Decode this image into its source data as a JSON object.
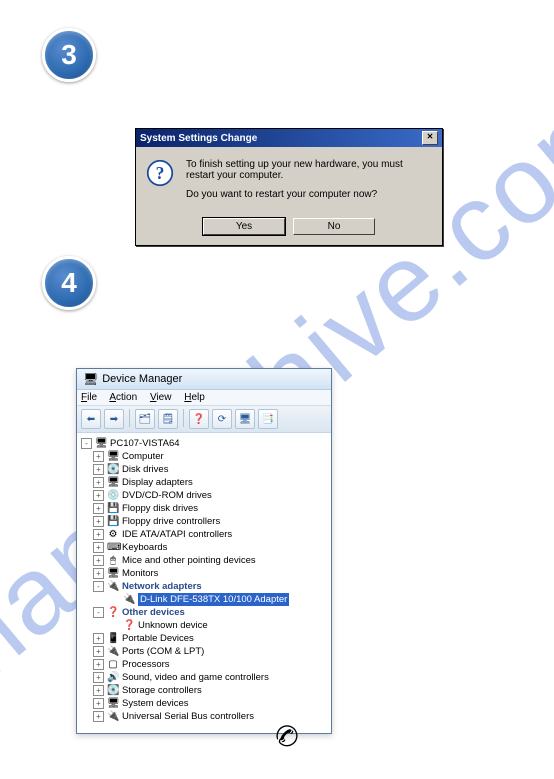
{
  "watermark": "manualshive.com",
  "steps": {
    "s3": "3",
    "s4": "4"
  },
  "dialog": {
    "title": "System Settings Change",
    "close_label": "✕",
    "msg1": "To finish setting up your new hardware, you must restart your computer.",
    "msg2": "Do you want to restart your computer now?",
    "yes": "Yes",
    "no": "No"
  },
  "devmgr": {
    "title": "Device Manager",
    "menu": {
      "file": "File",
      "action": "Action",
      "view": "View",
      "help": "Help"
    },
    "toolbar_icons": [
      "⬅",
      "➡",
      " ",
      "🗂",
      "🗒",
      " ",
      "❓",
      "⟳",
      "🖥",
      "📑"
    ],
    "root": "PC107-VISTA64",
    "nodes": [
      {
        "exp": "+",
        "icon": "🖥",
        "label": "Computer"
      },
      {
        "exp": "+",
        "icon": "💽",
        "label": "Disk drives"
      },
      {
        "exp": "+",
        "icon": "🖥",
        "label": "Display adapters"
      },
      {
        "exp": "+",
        "icon": "💿",
        "label": "DVD/CD-ROM drives"
      },
      {
        "exp": "+",
        "icon": "💾",
        "label": "Floppy disk drives"
      },
      {
        "exp": "+",
        "icon": "💾",
        "label": "Floppy drive controllers"
      },
      {
        "exp": "+",
        "icon": "⚙",
        "label": "IDE ATA/ATAPI controllers"
      },
      {
        "exp": "+",
        "icon": "⌨",
        "label": "Keyboards"
      },
      {
        "exp": "+",
        "icon": "🖱",
        "label": "Mice and other pointing devices"
      },
      {
        "exp": "+",
        "icon": "🖥",
        "label": "Monitors"
      },
      {
        "exp": "-",
        "icon": "🔌",
        "label": "Network adapters",
        "bold": true,
        "children": [
          {
            "icon": "🔌",
            "label": "D-Link DFE-538TX 10/100 Adapter",
            "selected": true
          }
        ]
      },
      {
        "exp": "-",
        "icon": "❓",
        "label": "Other devices",
        "bold": true,
        "children": [
          {
            "icon": "❓",
            "label": "Unknown device"
          }
        ]
      },
      {
        "exp": "+",
        "icon": "📱",
        "label": "Portable Devices"
      },
      {
        "exp": "+",
        "icon": "🔌",
        "label": "Ports (COM & LPT)"
      },
      {
        "exp": "+",
        "icon": "▢",
        "label": "Processors"
      },
      {
        "exp": "+",
        "icon": "🔊",
        "label": "Sound, video and game controllers"
      },
      {
        "exp": "+",
        "icon": "💽",
        "label": "Storage controllers"
      },
      {
        "exp": "+",
        "icon": "🖥",
        "label": "System devices"
      },
      {
        "exp": "+",
        "icon": "🔌",
        "label": "Universal Serial Bus controllers"
      }
    ]
  }
}
